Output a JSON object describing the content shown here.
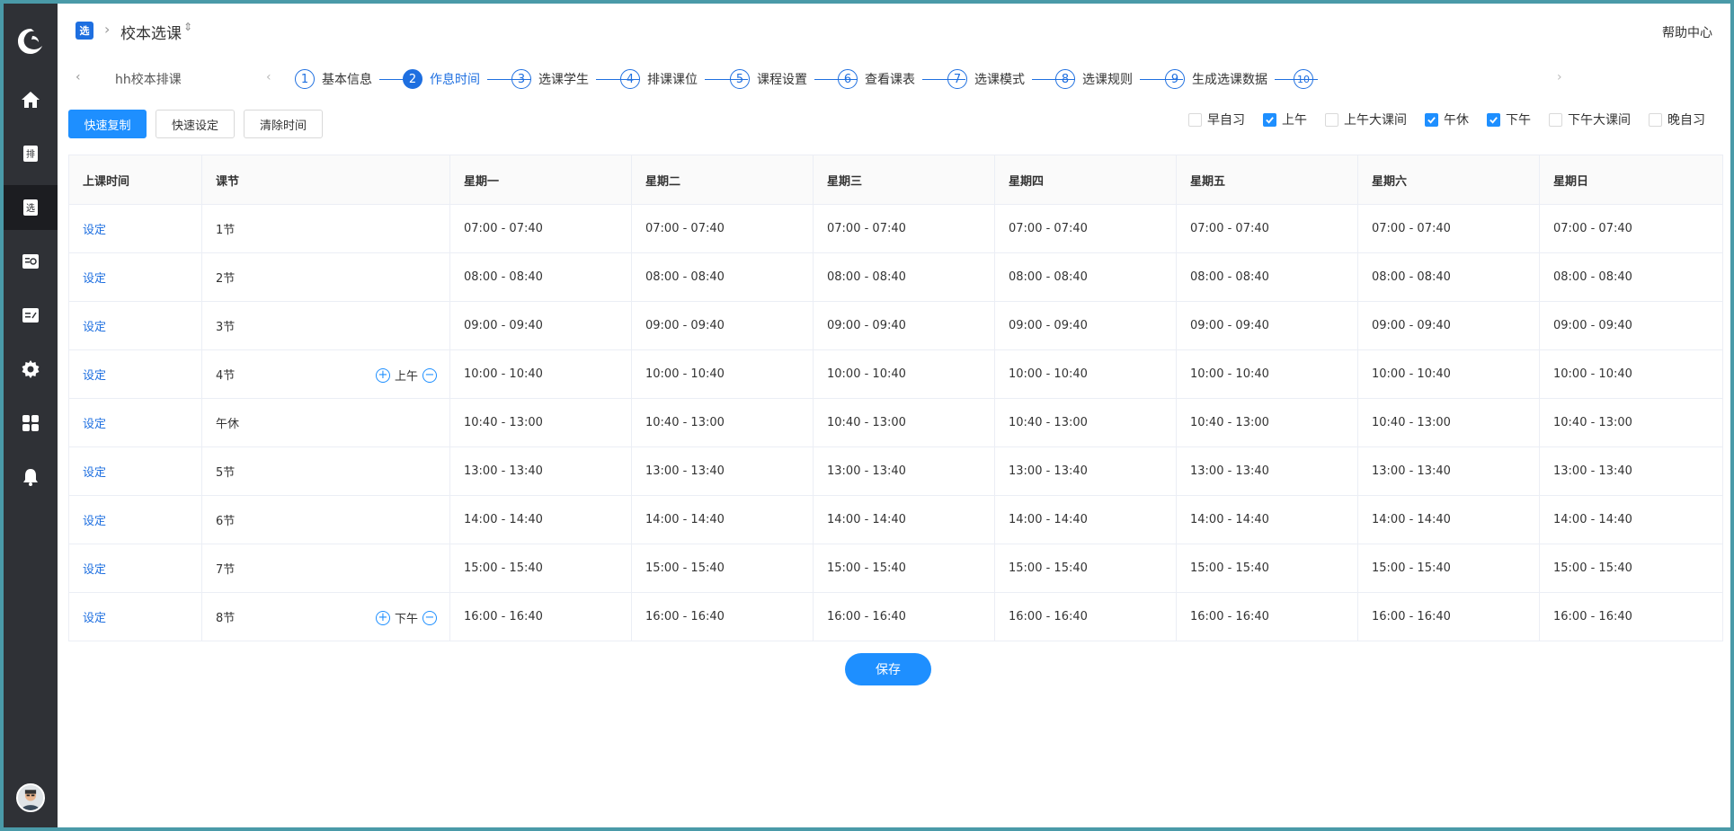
{
  "header": {
    "app_badge": "选",
    "app_title": "校本选课",
    "help": "帮助中心"
  },
  "stepbar": {
    "school": "hh校本排课",
    "steps": [
      {
        "num": "1",
        "label": "基本信息"
      },
      {
        "num": "2",
        "label": "作息时间"
      },
      {
        "num": "3",
        "label": "选课学生"
      },
      {
        "num": "4",
        "label": "排课课位"
      },
      {
        "num": "5",
        "label": "课程设置"
      },
      {
        "num": "6",
        "label": "查看课表"
      },
      {
        "num": "7",
        "label": "选课模式"
      },
      {
        "num": "8",
        "label": "选课规则"
      },
      {
        "num": "9",
        "label": "生成选课数据"
      },
      {
        "num": "10",
        "label": ""
      }
    ],
    "active_step": 2
  },
  "toolbar": {
    "quick_copy": "快速复制",
    "quick_set": "快速设定",
    "clear_time": "清除时间"
  },
  "filters": [
    {
      "label": "早自习",
      "checked": false
    },
    {
      "label": "上午",
      "checked": true
    },
    {
      "label": "上午大课间",
      "checked": false
    },
    {
      "label": "午休",
      "checked": true
    },
    {
      "label": "下午",
      "checked": true
    },
    {
      "label": "下午大课间",
      "checked": false
    },
    {
      "label": "晚自习",
      "checked": false
    }
  ],
  "table": {
    "headers": [
      "上课时间",
      "课节",
      "星期一",
      "星期二",
      "星期三",
      "星期四",
      "星期五",
      "星期六",
      "星期日"
    ],
    "set_label": "设定",
    "rows": [
      {
        "period": "1节",
        "time": "07:00 - 07:40"
      },
      {
        "period": "2节",
        "time": "08:00 - 08:40"
      },
      {
        "period": "3节",
        "time": "09:00 - 09:40"
      },
      {
        "period": "4节",
        "time": "10:00 - 10:40",
        "segment": "上午"
      },
      {
        "period": "午休",
        "time": "10:40 - 13:00"
      },
      {
        "period": "5节",
        "time": "13:00 - 13:40"
      },
      {
        "period": "6节",
        "time": "14:00 - 14:40"
      },
      {
        "period": "7节",
        "time": "15:00 - 15:40"
      },
      {
        "period": "8节",
        "time": "16:00 - 16:40",
        "segment": "下午"
      }
    ]
  },
  "save_label": "保存",
  "colors": {
    "accent": "#1e8fff",
    "sidebar": "#2f3136",
    "link": "#1e6fe0"
  }
}
